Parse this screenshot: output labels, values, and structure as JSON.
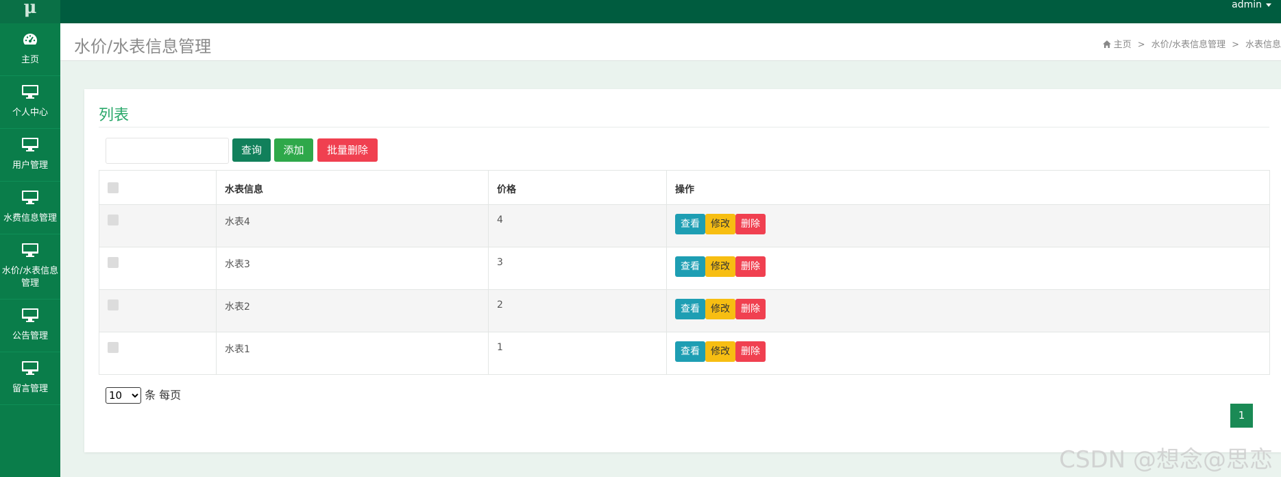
{
  "topbar": {
    "logo": "μ",
    "user": "admin"
  },
  "sidebar": {
    "items": [
      {
        "label": "主页",
        "icon": "dashboard-icon"
      },
      {
        "label": "个人中心",
        "icon": "monitor-icon"
      },
      {
        "label": "用户管理",
        "icon": "monitor-icon"
      },
      {
        "label": "水费信息管理",
        "icon": "monitor-icon"
      },
      {
        "label": "水价/水表信息管理",
        "icon": "monitor-icon"
      },
      {
        "label": "公告管理",
        "icon": "monitor-icon"
      },
      {
        "label": "留言管理",
        "icon": "monitor-icon"
      }
    ]
  },
  "header": {
    "title": "水价/水表信息管理",
    "breadcrumb": [
      "主页",
      "水价/水表信息管理",
      "水表信息"
    ]
  },
  "panel": {
    "title": "列表",
    "search_placeholder": "",
    "buttons": {
      "query": "查询",
      "add": "添加",
      "batch_delete": "批量删除"
    }
  },
  "table": {
    "headers": [
      "",
      "水表信息",
      "价格",
      "操作"
    ],
    "rows": [
      {
        "info": "水表4",
        "price": "4"
      },
      {
        "info": "水表3",
        "price": "3"
      },
      {
        "info": "水表2",
        "price": "2"
      },
      {
        "info": "水表1",
        "price": "1"
      }
    ],
    "actions": {
      "view": "查看",
      "edit": "修改",
      "delete": "删除"
    }
  },
  "pagination": {
    "page_size": "10",
    "page_size_suffix": "条 每页",
    "current_page": "1"
  },
  "watermark": "CSDN @想念@思恋",
  "colors": {
    "topbar": "#005c3f",
    "sidebar": "#0a7d4a",
    "accent": "#2aa86a",
    "danger": "#f04050",
    "warning": "#f7be12",
    "info": "#1e9eb3"
  }
}
